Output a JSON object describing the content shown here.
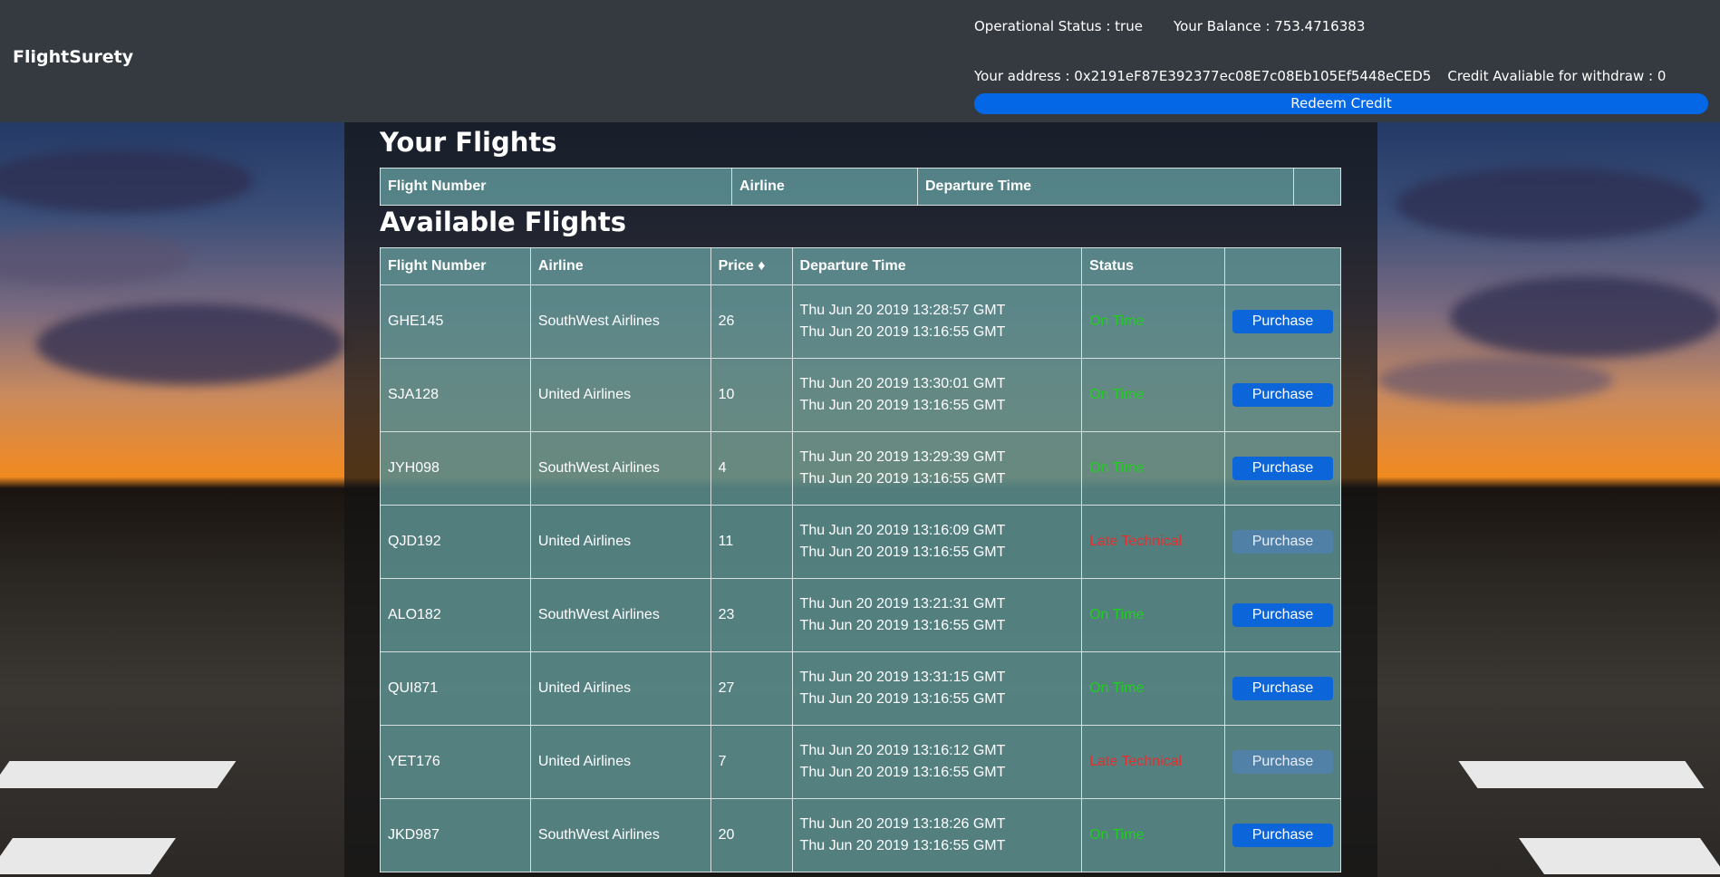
{
  "navbar": {
    "brand": "FlightSurety",
    "operational_status": "Operational Status : true",
    "balance": "Your Balance : 753.4716383",
    "address": "Your address : 0x2191eF87E392377ec08E7c08Eb105Ef5448eCED5",
    "credit": "Credit Avaliable for withdraw : 0",
    "redeem_label": "Redeem Credit"
  },
  "your_flights": {
    "title": "Your Flights",
    "columns": [
      "Flight Number",
      "Airline",
      "Departure Time",
      ""
    ]
  },
  "available_flights": {
    "title": "Available Flights",
    "columns": [
      "Flight Number",
      "Airline",
      "Price ♦",
      "Departure Time",
      "Status",
      ""
    ],
    "purchase_label": "Purchase",
    "rows": [
      {
        "flight": "GHE145",
        "airline": "SouthWest Airlines",
        "price": "26",
        "dep1": "Thu Jun 20 2019 13:28:57 GMT",
        "dep2": "Thu Jun 20 2019 13:16:55 GMT",
        "status": "On Time",
        "status_type": "ontime"
      },
      {
        "flight": "SJA128",
        "airline": "United Airlines",
        "price": "10",
        "dep1": "Thu Jun 20 2019 13:30:01 GMT",
        "dep2": "Thu Jun 20 2019 13:16:55 GMT",
        "status": "On Time",
        "status_type": "ontime"
      },
      {
        "flight": "JYH098",
        "airline": "SouthWest Airlines",
        "price": "4",
        "dep1": "Thu Jun 20 2019 13:29:39 GMT",
        "dep2": "Thu Jun 20 2019 13:16:55 GMT",
        "status": "On Time",
        "status_type": "ontime"
      },
      {
        "flight": "QJD192",
        "airline": "United Airlines",
        "price": "11",
        "dep1": "Thu Jun 20 2019 13:16:09 GMT",
        "dep2": "Thu Jun 20 2019 13:16:55 GMT",
        "status": "Late Technical",
        "status_type": "late"
      },
      {
        "flight": "ALO182",
        "airline": "SouthWest Airlines",
        "price": "23",
        "dep1": "Thu Jun 20 2019 13:21:31 GMT",
        "dep2": "Thu Jun 20 2019 13:16:55 GMT",
        "status": "On Time",
        "status_type": "ontime"
      },
      {
        "flight": "QUI871",
        "airline": "United Airlines",
        "price": "27",
        "dep1": "Thu Jun 20 2019 13:31:15 GMT",
        "dep2": "Thu Jun 20 2019 13:16:55 GMT",
        "status": "On Time",
        "status_type": "ontime"
      },
      {
        "flight": "YET176",
        "airline": "United Airlines",
        "price": "7",
        "dep1": "Thu Jun 20 2019 13:16:12 GMT",
        "dep2": "Thu Jun 20 2019 13:16:55 GMT",
        "status": "Late Technical",
        "status_type": "late"
      },
      {
        "flight": "JKD987",
        "airline": "SouthWest Airlines",
        "price": "20",
        "dep1": "Thu Jun 20 2019 13:18:26 GMT",
        "dep2": "Thu Jun 20 2019 13:16:55 GMT",
        "status": "On Time",
        "status_type": "ontime"
      }
    ]
  },
  "colors": {
    "navbar_bg": "#343a40",
    "accent_blue": "#0468e6",
    "status_ontime": "#22cc22",
    "status_late": "#e23030",
    "table_bg": "rgba(120,190,190,0.62)"
  }
}
